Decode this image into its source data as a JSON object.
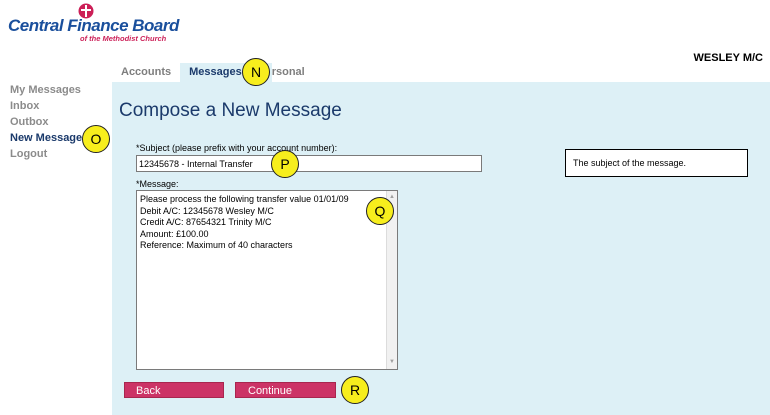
{
  "brand": {
    "title": "Central Finance Board",
    "subtitle": "of the Methodist Church"
  },
  "account_name": "WESLEY M/C",
  "sidebar": {
    "items": [
      {
        "label": "My Messages"
      },
      {
        "label": "Inbox"
      },
      {
        "label": "Outbox"
      },
      {
        "label": "New Message"
      },
      {
        "label": "Logout"
      }
    ]
  },
  "tabs": [
    {
      "label": "Accounts"
    },
    {
      "label": "Messages"
    },
    {
      "label": "rsonal"
    }
  ],
  "page": {
    "title": "Compose a New Message",
    "subject_label": "*Subject (please prefix with your account number):",
    "subject_value": "12345678 - Internal Transfer",
    "message_label": "*Message:",
    "message_value": "Please process the following transfer value 01/01/09\nDebit A/C: 12345678 Wesley M/C\nCredit A/C: 87654321 Trinity M/C\nAmount: £100.00\nReference: Maximum of 40 characters",
    "help_text": "The subject of the message.",
    "back_label": "Back",
    "continue_label": "Continue"
  },
  "callouts": {
    "n": "N",
    "o": "O",
    "p": "P",
    "q": "Q",
    "r": "R"
  },
  "colors": {
    "brand_blue": "#1a4f9c",
    "brand_red": "#cc1f57",
    "panel": "#ddf0f6",
    "button": "#cc3366",
    "callout": "#f7ee1d"
  }
}
